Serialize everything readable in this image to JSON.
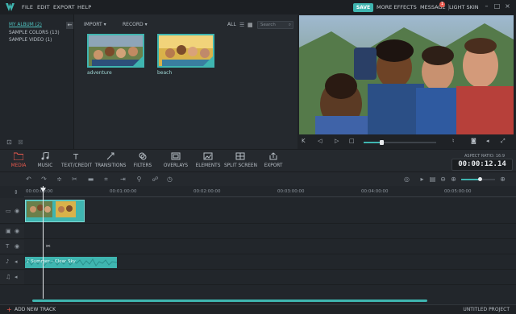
{
  "menu": {
    "items": [
      "FILE",
      "EDIT",
      "EXPORT",
      "HELP"
    ],
    "save_label": "SAVE",
    "more_effects": "MORE EFFECTS",
    "message": "MESSAGE",
    "message_badge": "1",
    "light_skin": "LIGHT SKIN"
  },
  "albums": {
    "items": [
      {
        "label": "MY ALBUM (2)",
        "active": true
      },
      {
        "label": "SAMPLE COLORS (13)",
        "active": false
      },
      {
        "label": "SAMPLE VIDEO (1)",
        "active": false
      }
    ]
  },
  "library": {
    "import_label": "IMPORT",
    "record_label": "RECORD",
    "filter_label": "ALL",
    "search_placeholder": "Search",
    "media": [
      {
        "label": "adventure"
      },
      {
        "label": "beach"
      }
    ]
  },
  "tabs": {
    "items": [
      {
        "label": "MEDIA",
        "icon": "folder-icon",
        "active": true
      },
      {
        "label": "MUSIC",
        "icon": "music-note-icon",
        "active": false
      },
      {
        "label": "TEXT/CREDIT",
        "icon": "text-icon",
        "active": false
      },
      {
        "label": "TRANSITIONS",
        "icon": "transition-icon",
        "active": false
      },
      {
        "label": "FILTERS",
        "icon": "filters-icon",
        "active": false
      },
      {
        "label": "OVERLAYS",
        "icon": "overlays-icon",
        "active": false
      },
      {
        "label": "ELEMENTS",
        "icon": "elements-icon",
        "active": false
      },
      {
        "label": "SPLIT SCREEN",
        "icon": "split-screen-icon",
        "active": false
      },
      {
        "label": "EXPORT",
        "icon": "export-icon",
        "active": false
      }
    ],
    "aspect_ratio": "ASPECT RATIO: 16:9",
    "timecode": "00:00:12.14"
  },
  "timeline": {
    "ruler": [
      "00:00:00:00",
      "00:01:00:00",
      "00:02:00:00",
      "00:03:00:00",
      "00:04:00:00",
      "00:05:00:00"
    ],
    "audio_clip_label": "Summer  – Clear Sky"
  },
  "bottom": {
    "add_track": "ADD NEW TRACK",
    "project_name": "UNTITLED PROJECT"
  },
  "colors": {
    "accent": "#3fb5b0",
    "active_tab": "#e8594d",
    "background": "#25292e"
  }
}
